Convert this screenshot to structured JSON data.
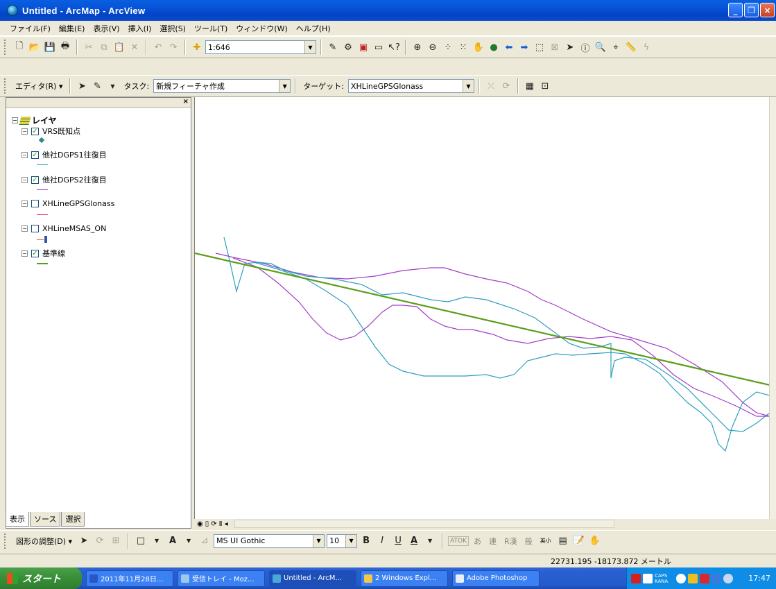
{
  "window": {
    "title": "Untitled - ArcMap - ArcView",
    "controls": [
      "_",
      "❐",
      "×"
    ]
  },
  "menu": [
    "ファイル(F)",
    "編集(E)",
    "表示(V)",
    "挿入(I)",
    "選択(S)",
    "ツール(T)",
    "ウィンドウ(W)",
    "ヘルプ(H)"
  ],
  "standard_toolbar": {
    "scale": "1:646"
  },
  "editor_toolbar": {
    "editor_label": "エディタ(R) ▾",
    "task_label": "タスク:",
    "task_value": "新規フィーチャ作成",
    "target_label": "ターゲット:",
    "target_value": "XHLineGPSGlonass"
  },
  "toc": {
    "root": "レイヤ",
    "layers": [
      {
        "name": "VRS既知点",
        "checked": true,
        "color": "#2e8b8b"
      },
      {
        "name": "他社DGPS1往復目",
        "checked": true,
        "color": "#2c9ec0"
      },
      {
        "name": "他社DGPS2往復目",
        "checked": true,
        "color": "#a33cc9"
      },
      {
        "name": "XHLineGPSGlonass",
        "checked": false,
        "color": "#e0304a"
      },
      {
        "name": "XHLineMSAS_ON",
        "checked": false,
        "color": "#e8703a"
      },
      {
        "name": "基準線",
        "checked": true,
        "color": "#5a9e1a"
      }
    ],
    "tabs": [
      "表示",
      "ソース",
      "選択"
    ]
  },
  "draw_toolbar": {
    "adjust_label": "図形の調整(D) ▾",
    "font": "MS UI Gothic",
    "size": "10",
    "bold": "B",
    "italic": "I",
    "underline": "U",
    "color_a": "A",
    "ime": [
      "ATOK",
      "あ",
      "連",
      "R漢",
      "般",
      "英小"
    ]
  },
  "status": {
    "coords": "22731.195  -18173.872 メートル"
  },
  "taskbar": {
    "start": "スタート",
    "tasks": [
      "2011年11月28日...",
      "受信トレイ - Moz...",
      "Untitled - ArcM...",
      "2 Windows Expl...",
      "Adobe Photoshop"
    ],
    "tray_text": "CAPS KANA",
    "clock": "17:47"
  }
}
